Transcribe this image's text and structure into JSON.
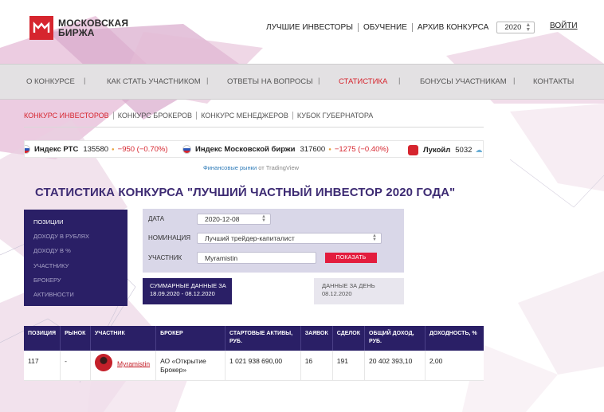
{
  "header": {
    "logo_line1": "МОСКОВСКАЯ",
    "logo_line2": "БИРЖА",
    "top_links": [
      "ЛУЧШИЕ ИНВЕСТОРЫ",
      "ОБУЧЕНИЕ",
      "АРХИВ КОНКУРСА"
    ],
    "year": "2020",
    "login": "ВОЙТИ"
  },
  "main_nav": [
    "О КОНКУРСЕ",
    "КАК СТАТЬ УЧАСТНИКОМ",
    "ОТВЕТЫ НА ВОПРОСЫ",
    "СТАТИСТИКА",
    "БОНУСЫ УЧАСТНИКАМ",
    "КОНТАКТЫ"
  ],
  "sub_nav": [
    "КОНКУРС ИНВЕСТОРОВ",
    "КОНКУРС БРОКЕРОВ",
    "КОНКУРС МЕНЕДЖЕРОВ",
    "КУБОК ГУБЕРНАТОРА"
  ],
  "ticker": [
    {
      "name": "Индекс РТС",
      "value": "135580",
      "change": "−950 (−0.70%)"
    },
    {
      "name": "Индекс Московской биржи",
      "value": "317600",
      "change": "−1275 (−0.40%)"
    },
    {
      "name": "Лукойл",
      "value": "5032"
    }
  ],
  "tv_credit": {
    "link": "Финансовые рынки",
    "suffix": "от TradingView"
  },
  "page_title": "СТАТИСТИКА КОНКУРСА \"ЛУЧШИЙ ЧАСТНЫЙ ИНВЕСТОР 2020 ГОДА\"",
  "side_menu": [
    "ПОЗИЦИИ",
    "ДОХОДУ В РУБЛЯХ",
    "ДОХОДУ В %",
    "УЧАСТНИКУ",
    "БРОКЕРУ",
    "АКТИВНОСТИ"
  ],
  "filters": {
    "date_label": "ДАТА",
    "date_value": "2020-12-08",
    "nomination_label": "НОМИНАЦИЯ",
    "nomination_value": "Лучший трейдер-капиталист",
    "participant_label": "УЧАСТНИК",
    "participant_value": "Myramistin",
    "show_button": "ПОКАЗАТЬ"
  },
  "tabs": {
    "summary_line1": "СУММАРНЫЕ ДАННЫЕ ЗА",
    "summary_line2": "18.09.2020 - 08.12.2020",
    "day_line1": "ДАННЫЕ ЗА ДЕНЬ",
    "day_line2": "08.12.2020"
  },
  "table": {
    "headers": [
      "ПОЗИЦИЯ",
      "РЫНОК",
      "УЧАСТНИК",
      "БРОКЕР",
      "СТАРТОВЫЕ АКТИВЫ, РУБ.",
      "ЗАЯВОК",
      "СДЕЛОК",
      "ОБЩИЙ ДОХОД, РУБ.",
      "ДОХОДНОСТЬ, %"
    ],
    "row": {
      "position": "117",
      "market": "-",
      "participant": "Myramistin",
      "broker": "АО «Открытие Брокер»",
      "start_assets": "1 021 938 690,00",
      "orders": "16",
      "deals": "191",
      "income": "20 402 393,10",
      "yield": "2,00"
    }
  },
  "colors": {
    "brand_red": "#d6252e",
    "dark_purple": "#2a1f66",
    "title_purple": "#3d2b73",
    "button_red": "#e31c3d"
  }
}
